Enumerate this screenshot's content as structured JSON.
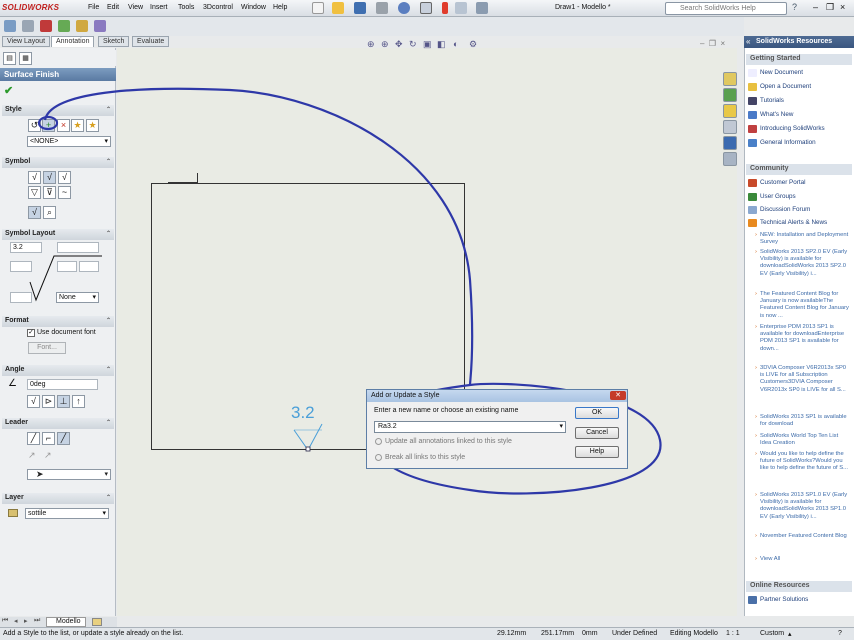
{
  "app": {
    "logo": "SOLIDWORKS",
    "doc_title": "Draw1 - Modello *"
  },
  "menus": [
    "File",
    "Edit",
    "View",
    "Insert",
    "Tools",
    "3Dcontrol",
    "Window",
    "Help"
  ],
  "search": {
    "placeholder": "Search SolidWorks Help"
  },
  "command_tabs": [
    "View Layout",
    "Annotation",
    "Sketch",
    "Evaluate"
  ],
  "property_manager": {
    "title": "Surface Finish",
    "style": {
      "header": "Style",
      "select": "<NONE>"
    },
    "symbol": {
      "header": "Symbol"
    },
    "symbol_layout": {
      "header": "Symbol Layout",
      "value": "3.2",
      "lay_select": "None"
    },
    "format": {
      "header": "Format",
      "use_doc_font": "Use document font",
      "font_button": "Font..."
    },
    "angle": {
      "header": "Angle",
      "value": "0deg"
    },
    "leader": {
      "header": "Leader"
    },
    "layer": {
      "header": "Layer",
      "select": "sottile"
    }
  },
  "canvas": {
    "annotation": "3.2",
    "sheet_tab": "Modello"
  },
  "dialog": {
    "title": "Add or Update a Style",
    "prompt": "Enter a new name or choose an existing name",
    "input_value": "Ra3.2",
    "update_all": "Update all annotations linked to this style",
    "break_all": "Break all links to this style",
    "ok": "OK",
    "cancel": "Cancel",
    "help": "Help"
  },
  "resources": {
    "title": "SolidWorks Resources",
    "getting_started": {
      "header": "Getting Started",
      "items": [
        "New Document",
        "Open a Document",
        "Tutorials",
        "What's New",
        "Introducing SolidWorks",
        "General Information"
      ]
    },
    "community": {
      "header": "Community",
      "items": [
        "Customer Portal",
        "User Groups",
        "Discussion Forum",
        "Technical Alerts & News"
      ]
    },
    "news": [
      "NEW: Installation and Deployment Survey",
      "SolidWorks 2013 SP2.0 EV (Early Visibility) is available for downloadSolidWorks 2013 SP2.0 EV (Early Visibility) i...",
      "The Featured Content Blog for January is now availableThe Featured Content Blog for January is now ...",
      "Enterprise PDM 2013 SP1 is available for downloadEnterprise PDM 2013 SP1 is available for down...",
      "3DVIA Composer V6R2013x SP0 is LIVE for all Subscription Customers3DVIA Composer V6R2013x SP0 is LIVE for all S...",
      "SolidWorks 2013 SP1 is available for download",
      "SolidWorks World Top Ten List Idea Creation",
      "Would you like to help define the future of SolidWorks?Would you like to help define the future of S...",
      "SolidWorks 2013 SP1.0 EV (Early Visibility) is available for downloadSolidWorks 2013 SP1.0 EV (Early Visibility) i...",
      "November Featured Content Blog"
    ],
    "view_all": "View All",
    "online": {
      "header": "Online Resources",
      "items": [
        "Partner Solutions"
      ]
    }
  },
  "status": {
    "message": "Add a Style to the list, or update a style already on the list.",
    "x": "29.12mm",
    "y": "251.17mm",
    "z": "0mm",
    "state": "Under Defined",
    "editing": "Editing Modello",
    "scale": "1 : 1",
    "units": "Custom"
  }
}
